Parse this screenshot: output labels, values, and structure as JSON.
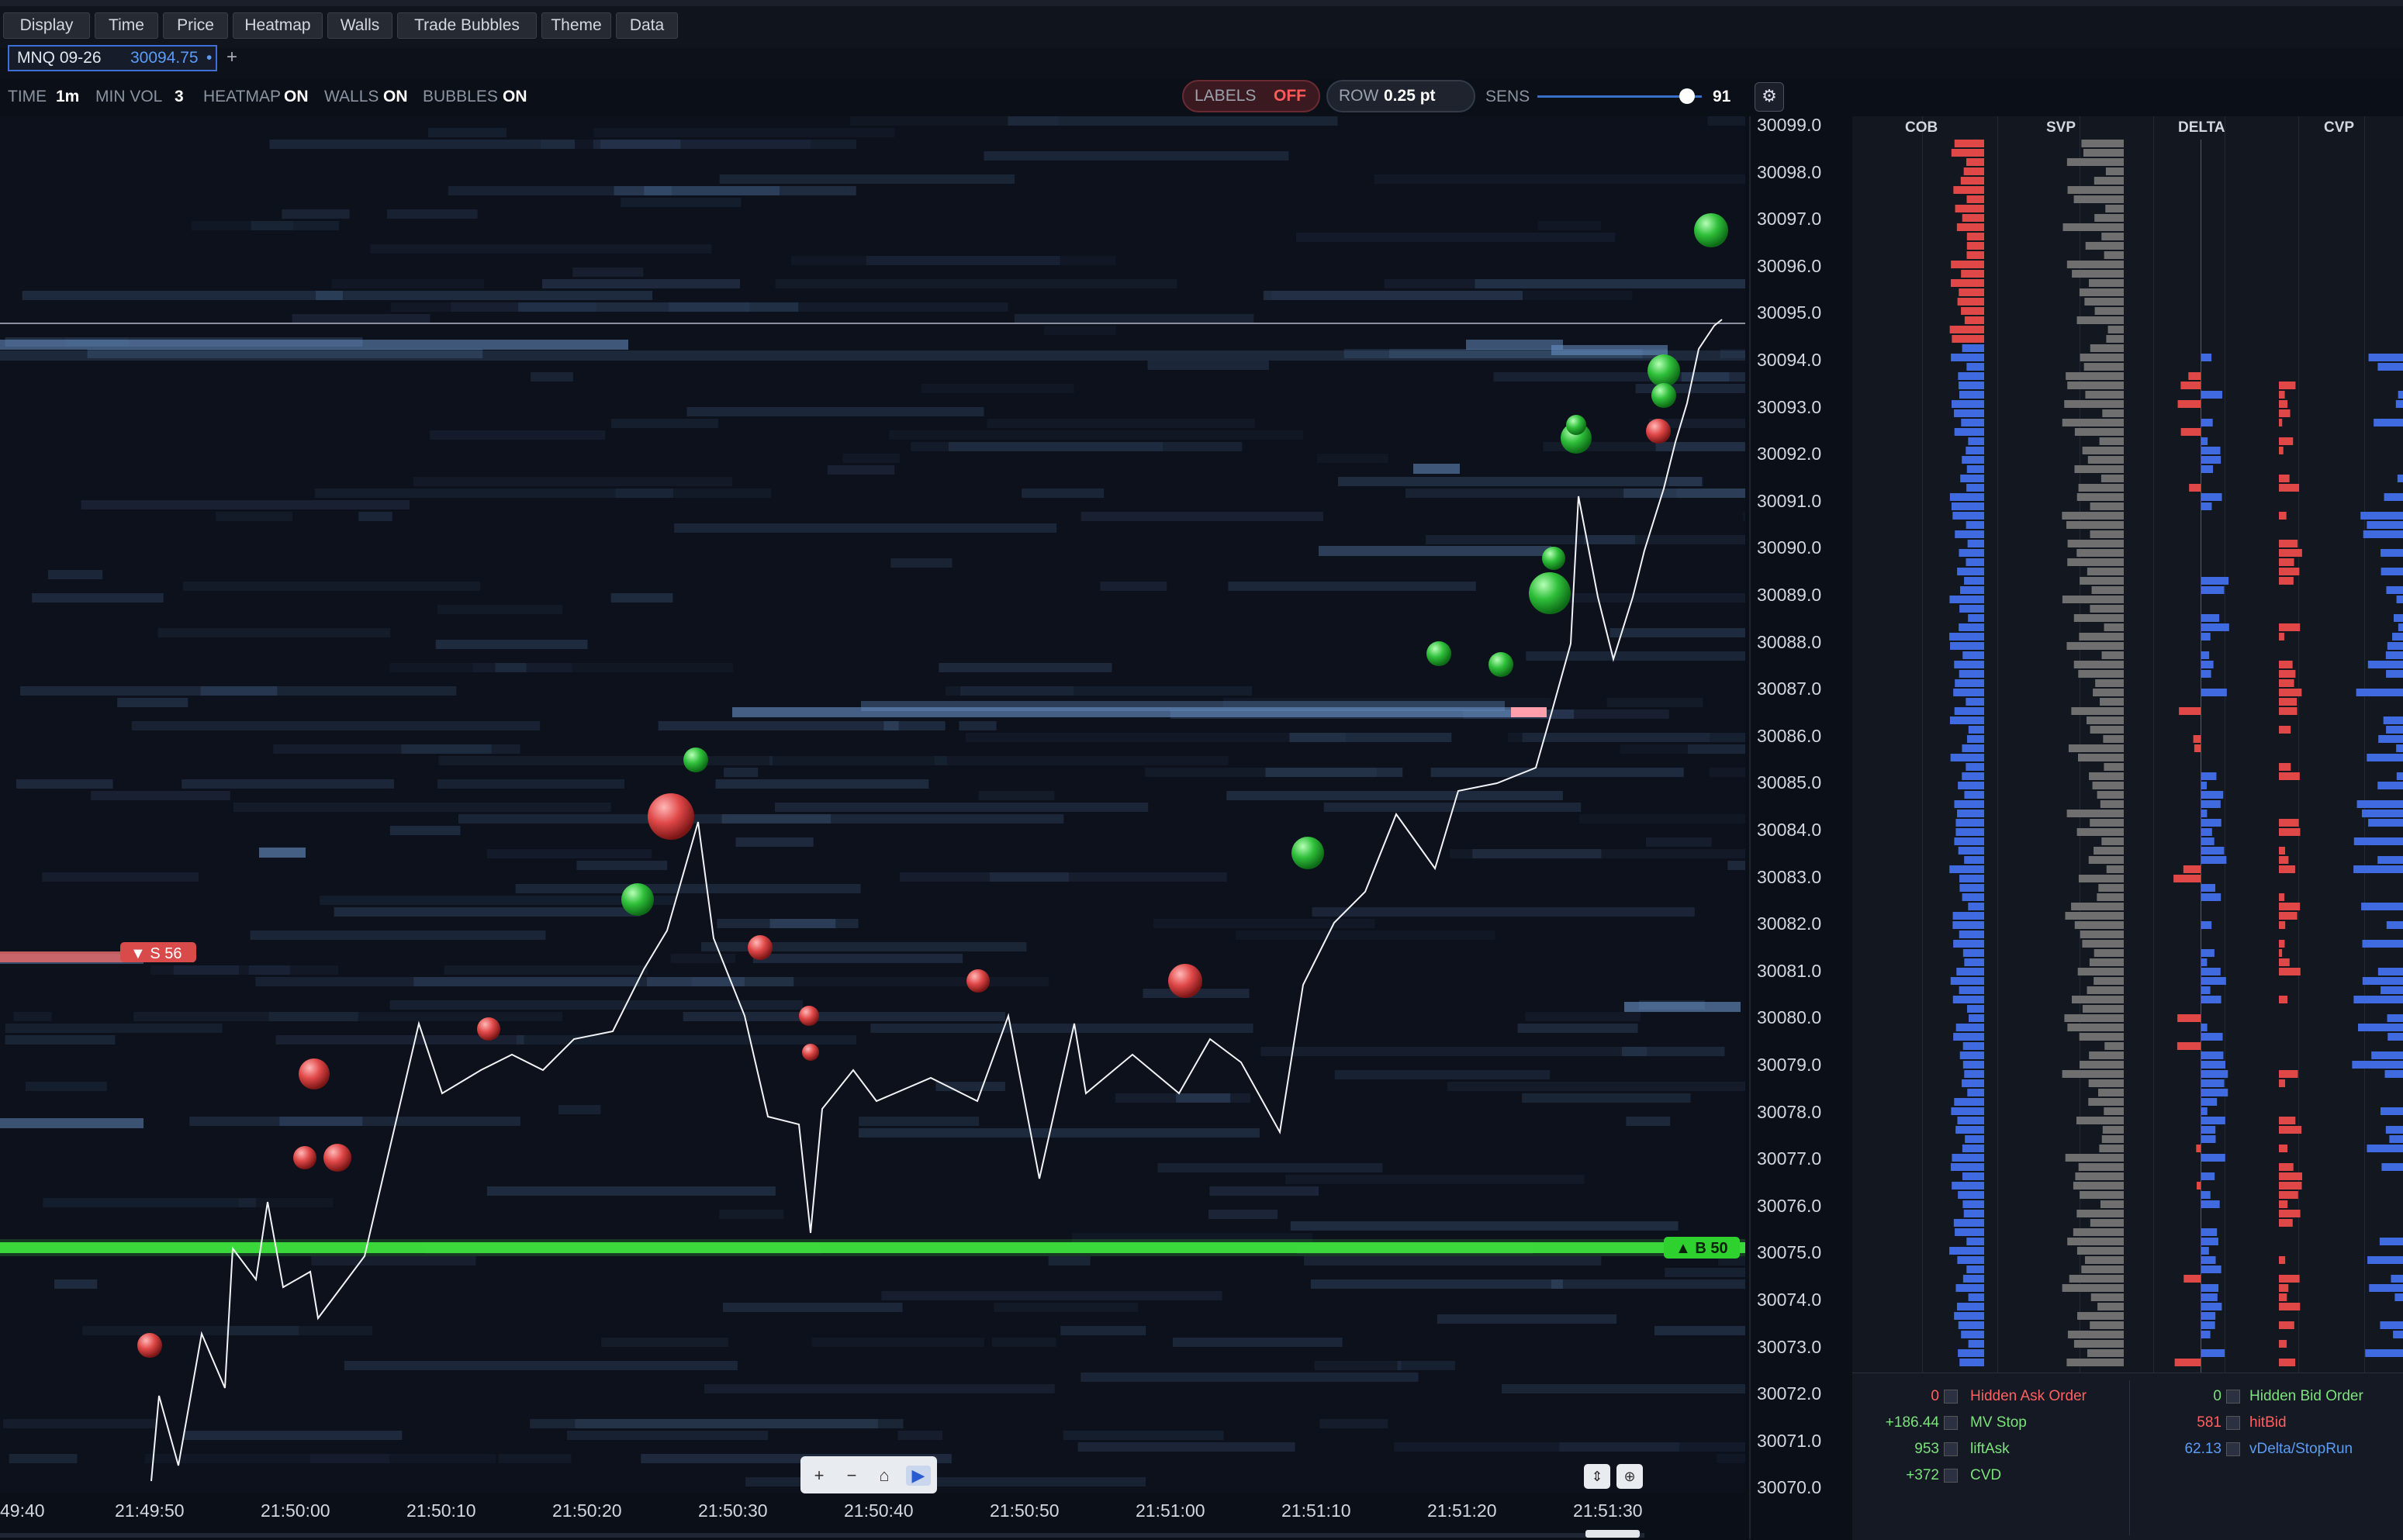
{
  "menu": {
    "display": "Display",
    "time": "Time",
    "price": "Price",
    "heatmap": "Heatmap",
    "walls": "Walls",
    "trade_bubbles": "Trade Bubbles",
    "theme": "Theme",
    "data": "Data"
  },
  "tab": {
    "symbol": "MNQ 09-26",
    "price": "30094.75",
    "add": "+"
  },
  "status": {
    "time_label": "TIME",
    "time_value": "1m",
    "minvol_label": "MIN VOL",
    "minvol_value": "3",
    "heatmap_label": "HEATMAP",
    "heatmap_value": "ON",
    "walls_label": "WALLS",
    "walls_value": "ON",
    "bubbles_label": "BUBBLES",
    "bubbles_value": "ON",
    "labels_label": "LABELS",
    "labels_value": "OFF",
    "row_label": "ROW",
    "row_value": "0.25 pt",
    "sens_label": "SENS",
    "sens_value": "91",
    "sens_level": 0.91
  },
  "price_axis": [
    "30099.0",
    "30098.0",
    "30097.0",
    "30096.0",
    "30095.0",
    "30094.0",
    "30093.0",
    "30092.0",
    "30091.0",
    "30090.0",
    "30089.0",
    "30088.0",
    "30087.0",
    "30086.0",
    "30085.0",
    "30084.0",
    "30083.0",
    "30082.0",
    "30081.0",
    "30080.0",
    "30079.0",
    "30078.0",
    "30077.0",
    "30076.0",
    "30075.0",
    "30074.0",
    "30073.0",
    "30072.0",
    "30071.0",
    "30070.0"
  ],
  "time_axis": [
    "49:40",
    "21:49:50",
    "21:50:00",
    "21:50:10",
    "21:50:20",
    "21:50:30",
    "21:50:40",
    "21:50:50",
    "21:51:00",
    "21:51:10",
    "21:51:20",
    "21:51:30"
  ],
  "walls": {
    "sell_label": "▼ S 56",
    "buy_label": "▲ B 50"
  },
  "columns": {
    "cob": "COB",
    "svp": "SVP",
    "delta": "DELTA",
    "cvp": "CVP"
  },
  "legend": {
    "hidden_ask_value": "0",
    "hidden_ask_label": "Hidden Ask Order",
    "mv_stop_value": "+186.44",
    "mv_stop_label": "MV Stop",
    "lift_ask_value": "953",
    "lift_ask_label": "liftAsk",
    "cvd_value": "+372",
    "cvd_label": "CVD",
    "hidden_bid_value": "0",
    "hidden_bid_label": "Hidden Bid Order",
    "hit_bid_value": "581",
    "hit_bid_label": "hitBid",
    "vdelta_value": "62.13",
    "vdelta_label": "vDelta/StopRun"
  },
  "controls": {
    "zoom_in": "+",
    "zoom_out": "−",
    "home": "⌂",
    "play": "▶"
  },
  "colors": {
    "accent": "#3e6ed8",
    "buy": "#2ecc40",
    "sell": "#e04848",
    "heat": "#5d86b8"
  },
  "icons": [
    "gear-icon",
    "play-icon",
    "home-icon",
    "lock-scale-icon",
    "crosshair-icon"
  ]
}
